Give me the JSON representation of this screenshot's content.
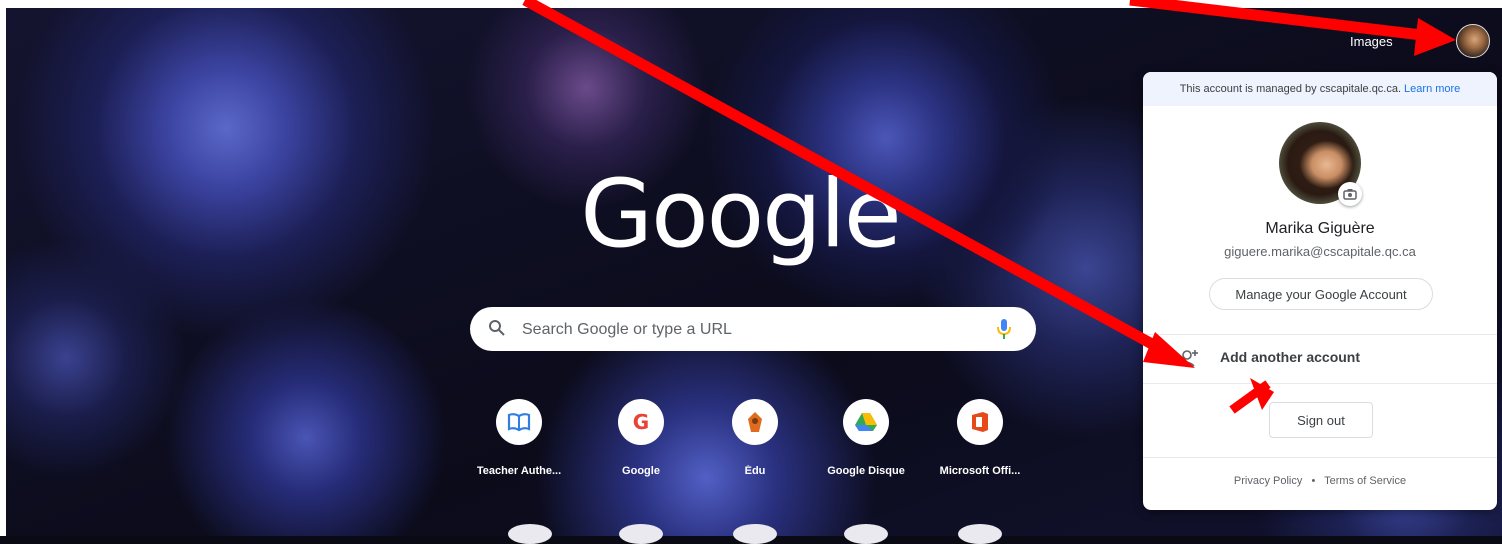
{
  "header": {
    "images_label": "Images",
    "apps_icon": "apps-grid-icon",
    "avatar_icon": "profile-avatar"
  },
  "logo": {
    "text": "Google"
  },
  "search": {
    "placeholder": "Search Google or type a URL",
    "search_icon": "search-icon",
    "mic_icon": "microphone-icon"
  },
  "shortcuts": [
    {
      "label": "Teacher Authe...",
      "icon": "book-icon",
      "color": "#2f7fe0"
    },
    {
      "label": "Google",
      "icon": "google-g-icon",
      "color": "#ea4335"
    },
    {
      "label": "Édu",
      "icon": "edu-icon",
      "color": "#e06b1f"
    },
    {
      "label": "Google Disque",
      "icon": "drive-icon",
      "color": "#34a853"
    },
    {
      "label": "Microsoft Offi...",
      "icon": "office-icon",
      "color": "#e64a19"
    }
  ],
  "account_popup": {
    "managed_text": "This account is managed by",
    "managed_domain": "cscapitale.qc.ca.",
    "learn_more": "Learn more",
    "name": "Marika Giguère",
    "email": "giguere.marika@cscapitale.qc.ca",
    "manage_button": "Manage your Google Account",
    "add_account": "Add another account",
    "sign_out": "Sign out",
    "privacy": "Privacy Policy",
    "separator": "•",
    "terms": "Terms of Service"
  },
  "colors": {
    "accent_link": "#1a73e8",
    "arrow": "#ff0000",
    "managed_banner": "#eef3fd"
  }
}
